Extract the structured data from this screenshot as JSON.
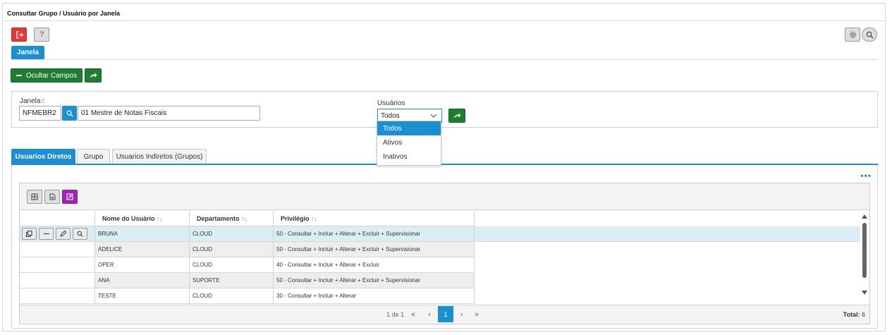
{
  "window": {
    "title": "Consultar Grupo / Usuário por Janela"
  },
  "toolbar": {
    "exit_icon": "exit-icon",
    "help_label": "?",
    "settings_icon": "gear-icon",
    "search_icon": "search-icon"
  },
  "tabs_top": {
    "janela": "Janela"
  },
  "actions": {
    "hide_fields": "Ocultar Campos"
  },
  "filters": {
    "janela_label": "Janela",
    "janela_code": "NFMEBR2",
    "janela_desc": "01  Mestre de Notas Fiscais",
    "usuarios_label": "Usuários",
    "usuarios_value": "Todos",
    "options": [
      "Todos",
      "Ativos",
      "Inativos"
    ]
  },
  "tabs": [
    "Usuarios Diretos",
    "Grupo",
    "Usuarios Indiretos (Grupos)"
  ],
  "more": "•••",
  "grid": {
    "columns": [
      "Nome do Usuário",
      "Departamento",
      "Privilégio"
    ],
    "sort_glyph": "↑↓",
    "rows": [
      {
        "nome": "BRUNA",
        "dep": "CLOUD",
        "priv": "50 - Consultar + Incluir + Alterar + Excluir + Supervisionar"
      },
      {
        "nome": "ADELICE",
        "dep": "CLOUD",
        "priv": "50 - Consultar + Incluir + Alterar + Excluir + Supervisionar"
      },
      {
        "nome": "OPER",
        "dep": "CLOUD",
        "priv": "40 - Consultar + Incluir + Alterar + Excluir"
      },
      {
        "nome": "ANA",
        "dep": "SUPORTE",
        "priv": "50 - Consultar + Incluir + Alterar + Excluir + Supervisionar"
      },
      {
        "nome": "TESTE",
        "dep": "CLOUD",
        "priv": "30 - Consultar + Incluir + Alterar"
      }
    ]
  },
  "pager": {
    "info": "1 de 1",
    "first": "«",
    "prev": "‹",
    "page": "1",
    "next": "›",
    "last": "»",
    "total_label": "Total:",
    "total_value": "6"
  },
  "colors": {
    "accent": "#1a8fd1",
    "green": "#1e7d32",
    "red": "#e53935",
    "purple": "#9c27b0"
  }
}
